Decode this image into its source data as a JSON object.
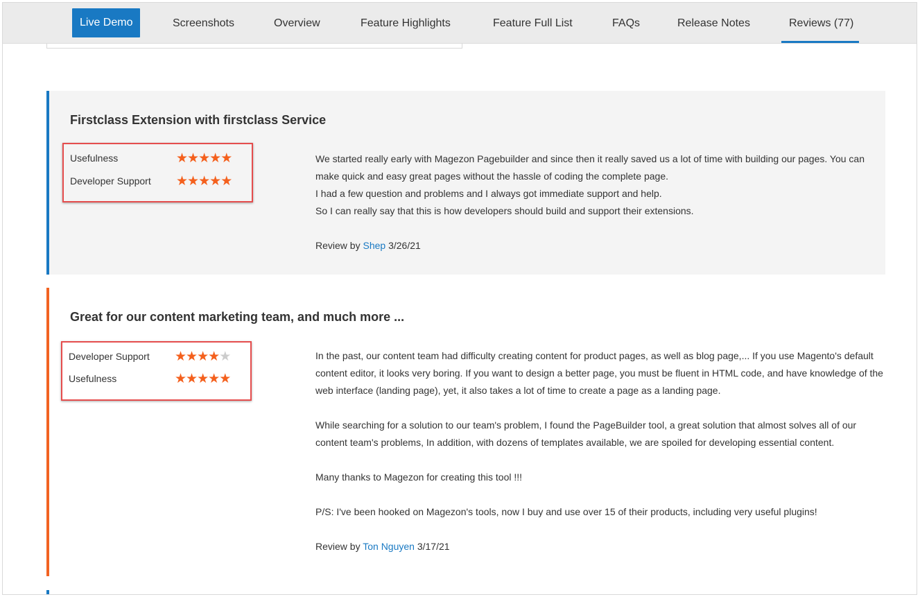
{
  "nav": {
    "live_demo": "Live Demo",
    "items": [
      "Screenshots",
      "Overview",
      "Feature Highlights",
      "Feature Full List",
      "FAQs",
      "Release Notes",
      "Reviews (77)"
    ],
    "active_index": 6,
    "accent_color": "#1979c3"
  },
  "reviews": [
    {
      "title": "Firstclass Extension with firstclass Service",
      "accent_color": "#1979c3",
      "ratings": [
        {
          "label": "Usefulness",
          "stars": 5,
          "max": 5
        },
        {
          "label": "Developer Support",
          "stars": 5,
          "max": 5
        }
      ],
      "paragraphs": [
        "We started really early with Magezon Pagebuilder and since then it really saved us a lot of time with building our pages. You can make quick and easy great pages without the hassle of coding the complete page.",
        "I had a few question and problems and I always got immediate support and help.",
        "So I can really say that this is how developers should build and support their extensions."
      ],
      "review_by_prefix": "Review by",
      "author": "Shep",
      "date": "3/26/21"
    },
    {
      "title": "Great for our content marketing team, and much more ...",
      "accent_color": "#f26322",
      "ratings": [
        {
          "label": "Developer Support",
          "stars": 4,
          "max": 5
        },
        {
          "label": "Usefulness",
          "stars": 5,
          "max": 5
        }
      ],
      "paragraphs": [
        "In the past, our content team had difficulty creating content for product pages, as well as blog page,... If you use Magento's default content editor, it looks very boring. If you want to design a better page, you must be fluent in HTML code, and have knowledge of the web interface (landing page), yet, it also takes a lot of time to create a page as a landing page.",
        "While searching for a solution to our team's problem, I found the PageBuilder tool, a great solution that almost solves all of our content team's problems, In addition, with dozens of templates available, we are spoiled for developing essential content.",
        "Many thanks to Magezon for creating this tool !!!",
        "P/S: I've been hooked on Magezon's tools, now I buy and use over 15 of their products, including very useful plugins!"
      ],
      "review_by_prefix": "Review by",
      "author": "Ton Nguyen",
      "date": "3/17/21"
    }
  ],
  "colors": {
    "star_on": "#f4601d",
    "star_off": "#cccccc",
    "highlight_box": "#e54d4d",
    "link": "#1979c3"
  },
  "icons": {
    "star": "star-icon"
  }
}
